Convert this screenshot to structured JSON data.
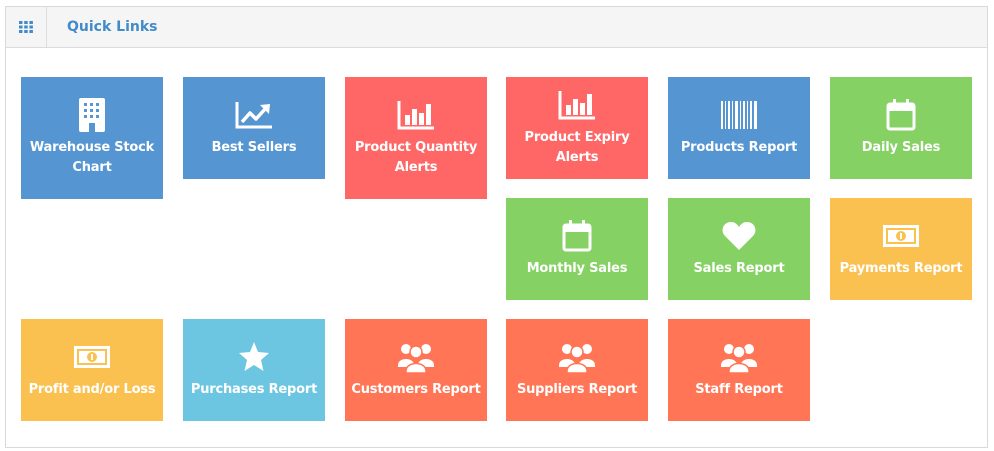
{
  "panel": {
    "title": "Quick Links",
    "header_icon": "grid-icon"
  },
  "colors": {
    "blue": "#5596d2",
    "red": "#ff6666",
    "green": "#85d164",
    "yellow": "#fac150",
    "teal": "#6cc5e1",
    "orange": "#ff7555",
    "title": "#428bca"
  },
  "tiles": [
    {
      "label": "Warehouse Stock Chart",
      "icon": "building-icon"
    },
    {
      "label": "Best Sellers",
      "icon": "trend-up-icon"
    },
    {
      "label": "Product Quantity Alerts",
      "icon": "bar-chart-icon"
    },
    {
      "label": "Product Expiry Alerts",
      "icon": "bar-chart-icon"
    },
    {
      "label": "Products Report",
      "icon": "barcode-icon"
    },
    {
      "label": "Daily Sales",
      "icon": "calendar-icon"
    },
    {
      "label": "Monthly Sales",
      "icon": "calendar-icon"
    },
    {
      "label": "Sales Report",
      "icon": "heart-icon"
    },
    {
      "label": "Payments Report",
      "icon": "money-icon"
    },
    {
      "label": "Profit and/or Loss",
      "icon": "money-icon"
    },
    {
      "label": "Purchases Report",
      "icon": "star-icon"
    },
    {
      "label": "Customers Report",
      "icon": "users-icon"
    },
    {
      "label": "Suppliers Report",
      "icon": "users-icon"
    },
    {
      "label": "Staff Report",
      "icon": "users-icon"
    }
  ]
}
